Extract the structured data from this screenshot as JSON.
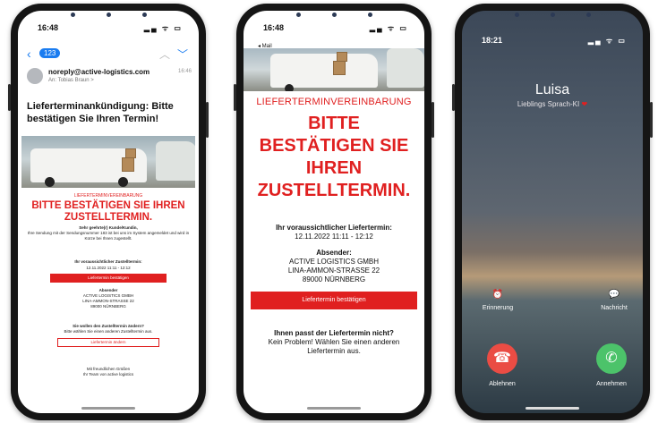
{
  "phone1": {
    "status_time": "16:48",
    "status_icons": "▂▄ ᯤ ▭",
    "back_count": "123",
    "from": "noreply@active-logistics.com",
    "to": "An: Tobias Braun >",
    "date": "16:46",
    "subject": "Lieferterminankündigung: Bitte bestätigen Sie Ihren Termin!",
    "tiny_red": "LIEFERTERMINVEREINBARUNG",
    "head_red": "BITTE BESTÄTIGEN SIE IHREN ZUSTELLTERMIN.",
    "greeting": "Sehr geehrte(r) Kunde/Kundin,",
    "intro": "Ihre Sendung mit der Sendungsnummer 183 ist bei uns im System angemeldet und wird in Kürze bei Ihnen zugestellt.",
    "date_label": "Ihr voraussichtlicher Zustelltermin:",
    "date_value": "12.11.2022 11:11 - 12:12",
    "confirm_btn": "Liefertermin bestätigen",
    "sender_label": "Absender",
    "sender_lines": [
      "ACTIVE LOGISTICS GMBH",
      "LINA-AMMON-STRASSE 22",
      "89000 NÜRNBERG"
    ],
    "change_q": "Sie wollen den Zustelltermin ändern?",
    "change_text": "Bitte wählen Sie einen anderen Zustelltermin aus.",
    "change_btn": "Liefertermin ändern",
    "closing1": "Mit freundlichen Grüßen",
    "closing2": "Ihr Team von active logistics"
  },
  "phone2": {
    "status_time": "16:48",
    "status_icons": "▂▄ ᯤ ▭",
    "back": "◂ Mail",
    "sub": "LIEFERTERMINVEREINBARUNG",
    "head": [
      "BITTE",
      "BESTÄTIGEN SIE",
      "IHREN",
      "ZUSTELLTERMIN."
    ],
    "date_label": "Ihr voraussichtlicher Liefertermin:",
    "date_value": "12.11.2022 11:11 - 12:12",
    "sender_label": "Absender:",
    "sender_lines": [
      "ACTIVE LOGISTICS GMBH",
      "LINA-AMMON-STRASSE 22",
      "89000 NÜRNBERG"
    ],
    "confirm_btn": "Liefertermin bestätigen",
    "q": "Ihnen passt der Liefertermin nicht?",
    "q_text": [
      "Kein Problem! Wählen Sie einen anderen",
      "Liefertermin aus."
    ]
  },
  "phone3": {
    "status_time": "18:21",
    "status_icons": "▂▄ ᯤ ▭",
    "caller": "Luisa",
    "caller_sub": "Lieblings Sprach-KI",
    "heart": "❤",
    "remind_icon": "⏰",
    "remind": "Erinnerung",
    "message_icon": "💬",
    "message": "Nachricht",
    "decline_icon": "☎",
    "decline": "Ablehnen",
    "accept_icon": "✆",
    "accept": "Annehmen"
  }
}
